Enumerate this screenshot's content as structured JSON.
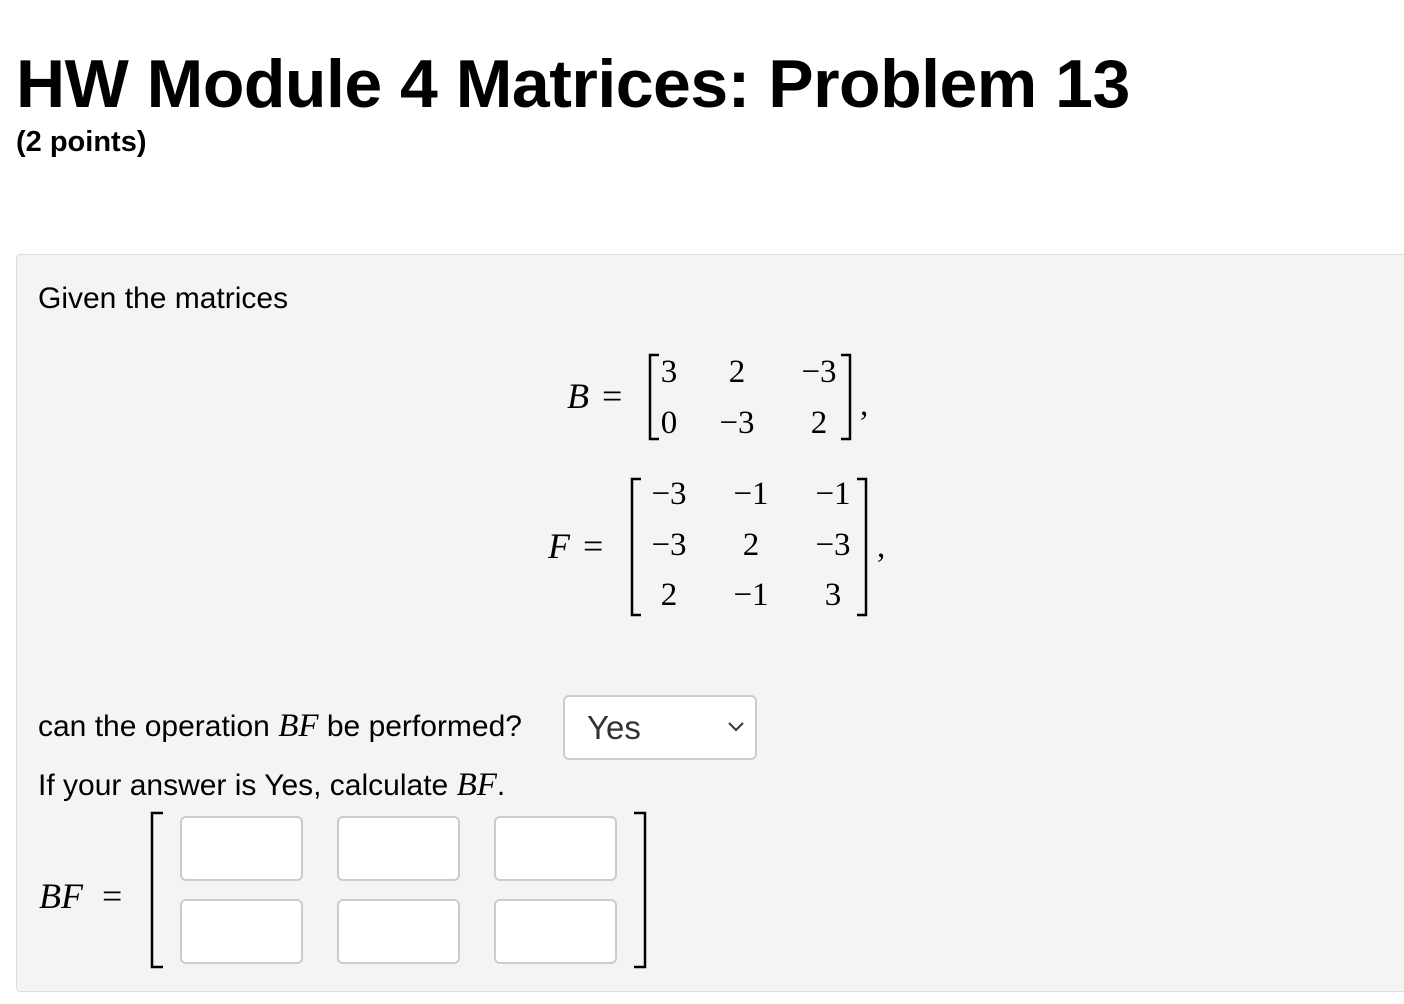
{
  "header": {
    "title": "HW Module 4 Matrices: Problem 13",
    "points": "(2 points)"
  },
  "problem": {
    "intro": "Given the matrices",
    "matrix_B": {
      "name": "B",
      "rows": [
        [
          "3",
          "2",
          "−3"
        ],
        [
          "0",
          "−3",
          "2"
        ]
      ]
    },
    "matrix_F": {
      "name": "F",
      "rows": [
        [
          "−3",
          "−1",
          "−1"
        ],
        [
          "−3",
          "2",
          "−3"
        ],
        [
          "2",
          "−1",
          "3"
        ]
      ]
    },
    "question_prefix": "can the operation",
    "question_math": "BF",
    "question_suffix": "be performed?",
    "answer_select": {
      "selected": "Yes"
    },
    "instruction_prefix": "If your answer is Yes, calculate",
    "instruction_math": "BF",
    "instruction_suffix": ".",
    "result_label": "BF",
    "equals": "=",
    "comma": ","
  }
}
